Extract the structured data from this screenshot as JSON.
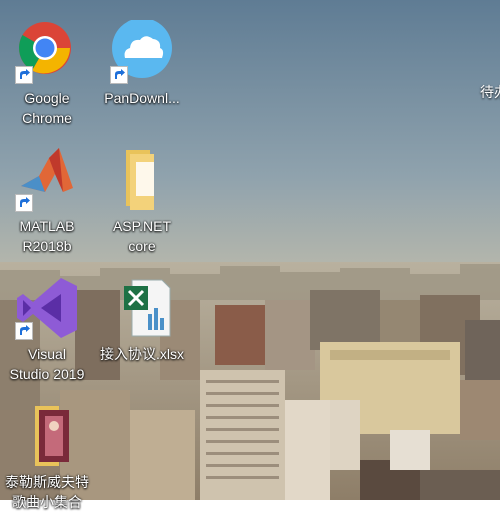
{
  "desktop": {
    "icons": [
      {
        "name": "google-chrome-icon",
        "label": "Google\nChrome"
      },
      {
        "name": "pandownload-icon",
        "label": "PanDownl..."
      },
      {
        "name": "matlab-icon",
        "label": "MATLAB\nR2018b"
      },
      {
        "name": "aspnet-folder-icon",
        "label": "ASP.NET\ncore"
      },
      {
        "name": "visual-studio-icon",
        "label": "Visual\nStudio 2019"
      },
      {
        "name": "excel-file-icon",
        "label": "接入协议.xlsx"
      },
      {
        "name": "album-folder-icon",
        "label": "泰勒斯威夫特\n歌曲小集合"
      }
    ],
    "edge_text": "待办"
  },
  "colors": {
    "chrome_red": "#DB4437",
    "chrome_yellow": "#F4B400",
    "chrome_green": "#0F9D58",
    "chrome_blue": "#4285F4",
    "pandownload_blue": "#5AB8F0",
    "vs_purple": "#8E5BD6",
    "folder_yellow": "#F3D27A",
    "excel_green": "#1E7145"
  }
}
